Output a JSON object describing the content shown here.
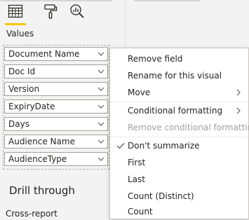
{
  "pane": {
    "tabs": [
      {
        "name": "fields-tab",
        "icon": "table-grid-icon"
      },
      {
        "name": "format-tab",
        "icon": "paint-roller-icon"
      },
      {
        "name": "analytics-tab",
        "icon": "magnifier-chart-icon"
      }
    ],
    "values_label": "Values",
    "fields": [
      "Document Name",
      "Doc Id",
      "Version",
      "ExpiryDate",
      "Days",
      "Audience Name",
      "AudienceType"
    ],
    "drill_heading": "Drill through",
    "cross_report": "Cross-report"
  },
  "menu": {
    "remove_field": "Remove field",
    "rename": "Rename for this visual",
    "move": "Move",
    "conditional_formatting": "Conditional formatting",
    "remove_conditional_formatting": "Remove conditional formatting",
    "dont_summarize": "Don't summarize",
    "first": "First",
    "last": "Last",
    "count_distinct": "Count (Distinct)",
    "count": "Count"
  },
  "colors": {
    "accent": "#f2c811",
    "disabled_text": "#a19f9d",
    "check": "#605e5c"
  }
}
